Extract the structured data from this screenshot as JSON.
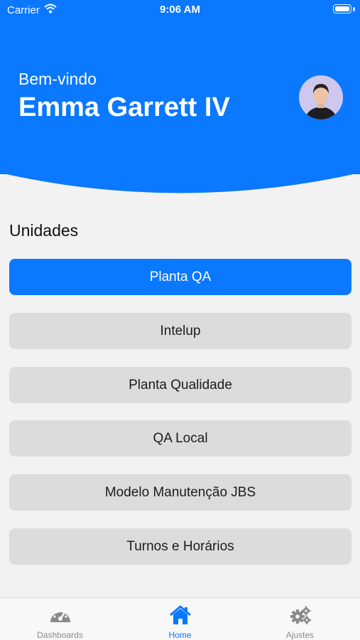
{
  "status_bar": {
    "carrier": "Carrier",
    "time": "9:06 AM"
  },
  "header": {
    "greeting": "Bem-vindo",
    "user_name": "Emma Garrett IV"
  },
  "units": {
    "title": "Unidades",
    "items": [
      {
        "label": "Planta QA",
        "selected": true
      },
      {
        "label": "Intelup",
        "selected": false
      },
      {
        "label": "Planta Qualidade",
        "selected": false
      },
      {
        "label": "QA Local",
        "selected": false
      },
      {
        "label": "Modelo Manutenção JBS",
        "selected": false
      },
      {
        "label": "Turnos e Horários",
        "selected": false
      }
    ]
  },
  "tabbar": {
    "tabs": [
      {
        "label": "Dashboards",
        "icon": "gauge-icon",
        "active": false
      },
      {
        "label": "Home",
        "icon": "home-icon",
        "active": true
      },
      {
        "label": "Ajustes",
        "icon": "gears-icon",
        "active": false
      }
    ]
  },
  "colors": {
    "accent": "#0a78ff",
    "button_bg": "#dcdcdc",
    "background": "#f2f2f2",
    "tab_inactive": "#8a8a8a"
  }
}
